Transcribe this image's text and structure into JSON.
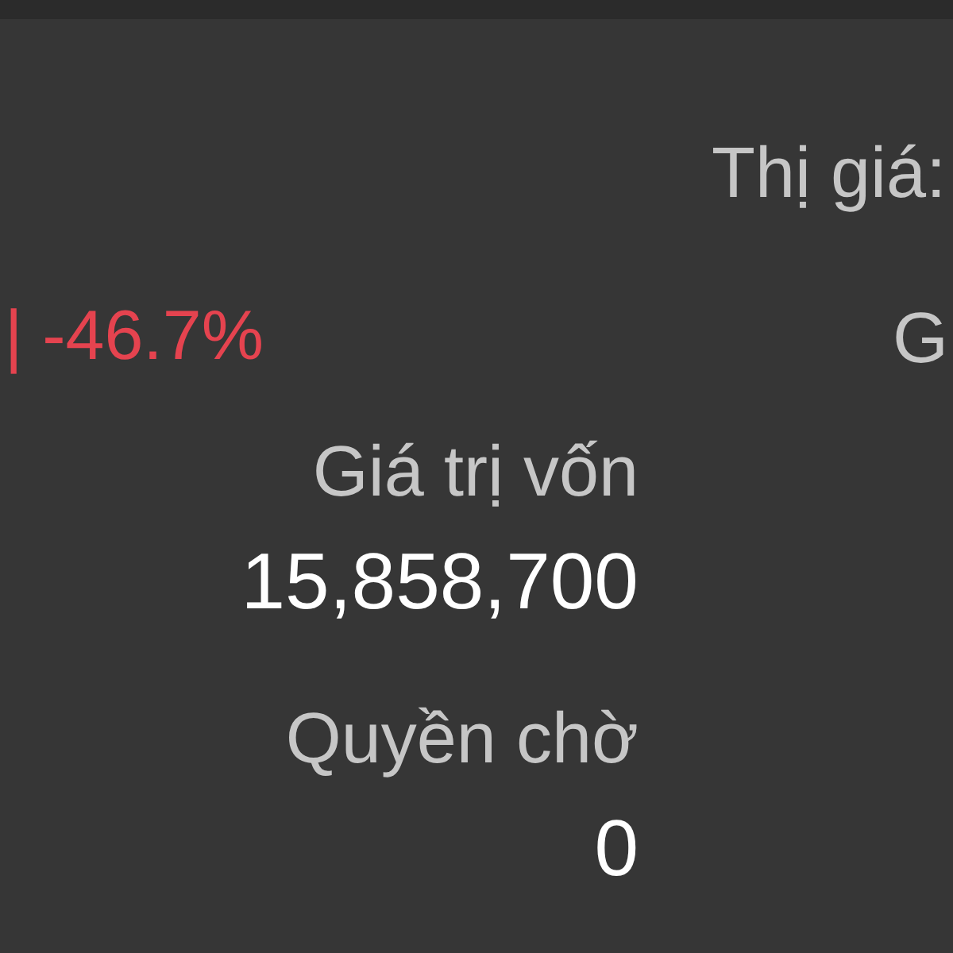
{
  "change": {
    "text": "| -46.7%"
  },
  "metrics": [
    {
      "label": "Giá trị vốn",
      "value": "15,858,700"
    },
    {
      "label": "Quyền chờ",
      "value": "0"
    }
  ],
  "right_column": [
    "Thị giá:",
    "G"
  ]
}
